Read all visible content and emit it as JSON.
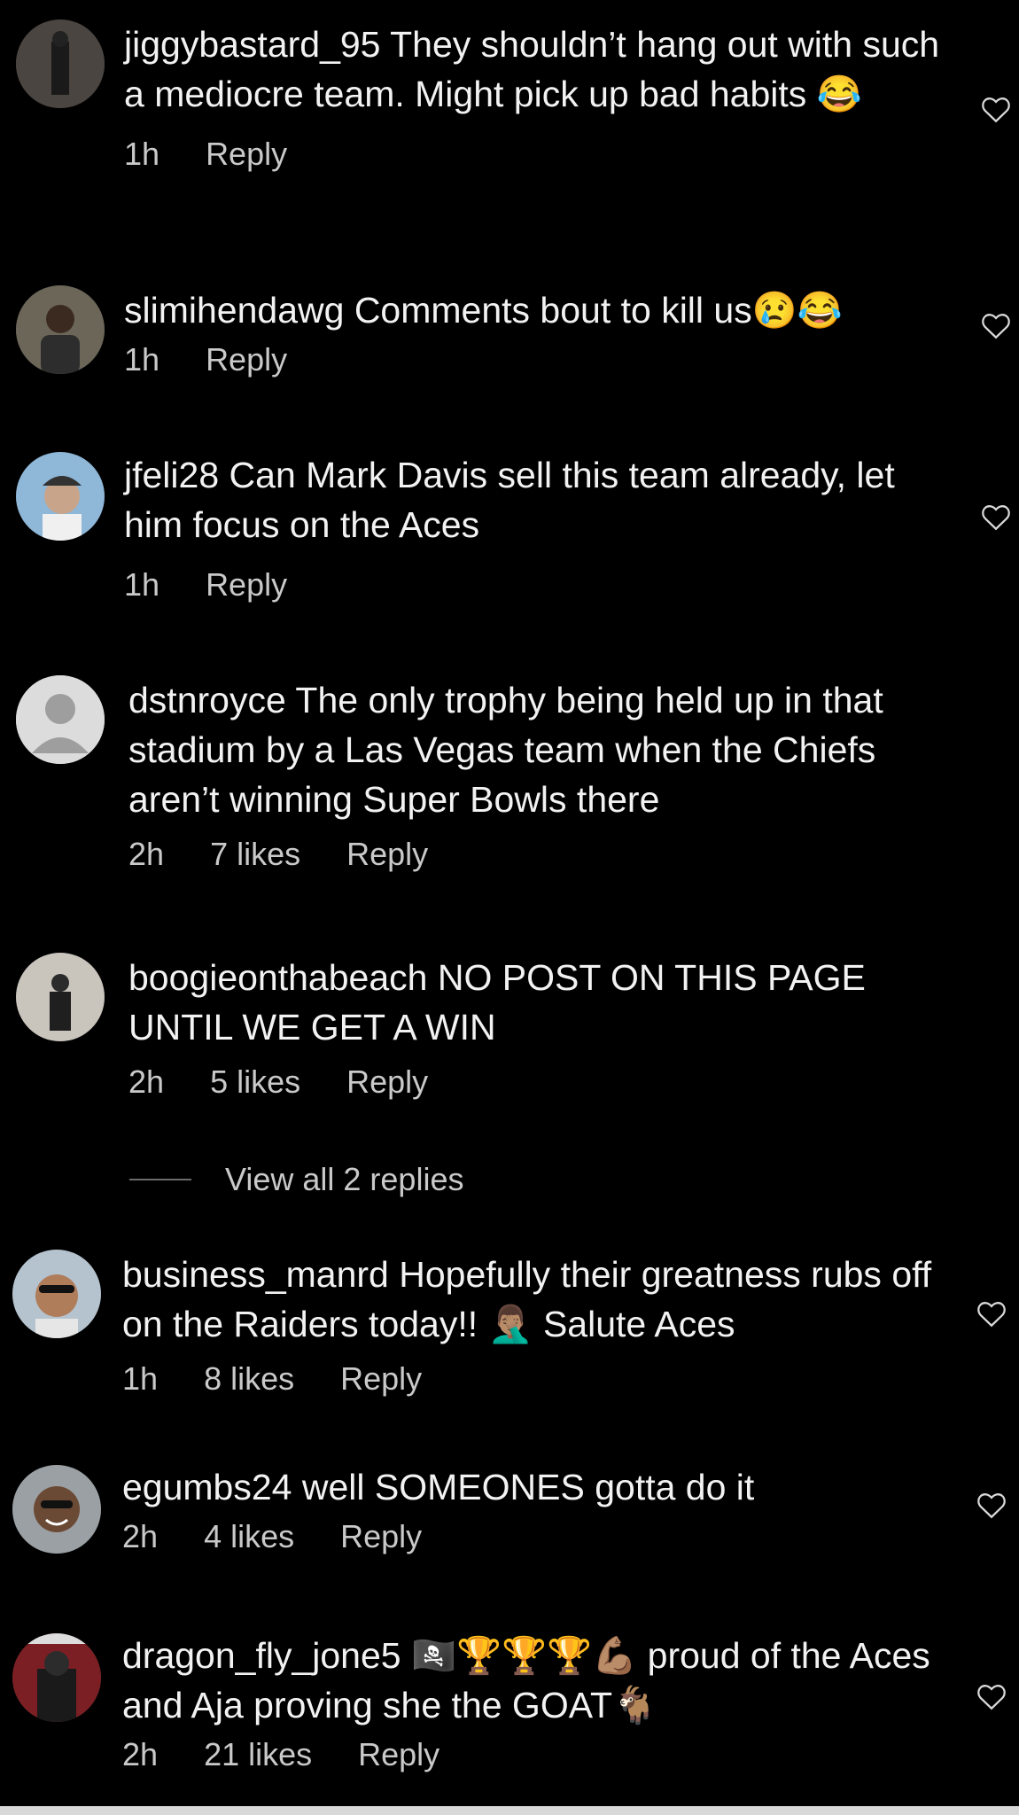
{
  "comments": [
    {
      "username": "jiggybastard_95",
      "text": "They shouldn’t hang out with such a mediocre team. Might pick up bad habits 😂",
      "time": "1h",
      "likes": "",
      "reply": "Reply",
      "avatar": "person-dark-photo"
    },
    {
      "username": "slimihendawg",
      "text": "Comments bout to kill us😢😂",
      "time": "1h",
      "likes": "",
      "reply": "Reply",
      "avatar": "person-photo"
    },
    {
      "username": "jfeli28",
      "text": "Can Mark Davis sell this team already, let him focus on the Aces",
      "time": "1h",
      "likes": "",
      "reply": "Reply",
      "avatar": "person-cap-photo"
    },
    {
      "username": "dstnroyce",
      "text": "The only trophy being held up in that stadium by a Las Vegas team when the Chiefs aren’t winning Super Bowls there",
      "time": "2h",
      "likes": "7 likes",
      "reply": "Reply",
      "avatar": "default-avatar"
    },
    {
      "username": "boogieonthabeach",
      "text": "NO POST ON THIS PAGE UNTIL WE GET A WIN",
      "time": "2h",
      "likes": "5 likes",
      "reply": "Reply",
      "avatar": "person-photo"
    },
    {
      "username": "business_manrd",
      "text": "Hopefully their greatness rubs off on the Raiders today!! 🤦🏽‍♂️ Salute Aces",
      "time": "1h",
      "likes": "8 likes",
      "reply": "Reply",
      "avatar": "person-sunglasses-photo"
    },
    {
      "username": "egumbs24",
      "text": "well SOMEONES gotta do it",
      "time": "2h",
      "likes": "4 likes",
      "reply": "Reply",
      "avatar": "person-smiling-photo"
    },
    {
      "username": "dragon_fly_jone5",
      "text": "🏴‍☠️🏆🏆🏆💪🏽 proud of the Aces and Aja proving she the GOAT🐐",
      "time": "2h",
      "likes": "21 likes",
      "reply": "Reply",
      "avatar": "person-photo"
    }
  ],
  "view_replies": "View all 2 replies",
  "icons": {
    "like": "heart-outline-icon"
  }
}
